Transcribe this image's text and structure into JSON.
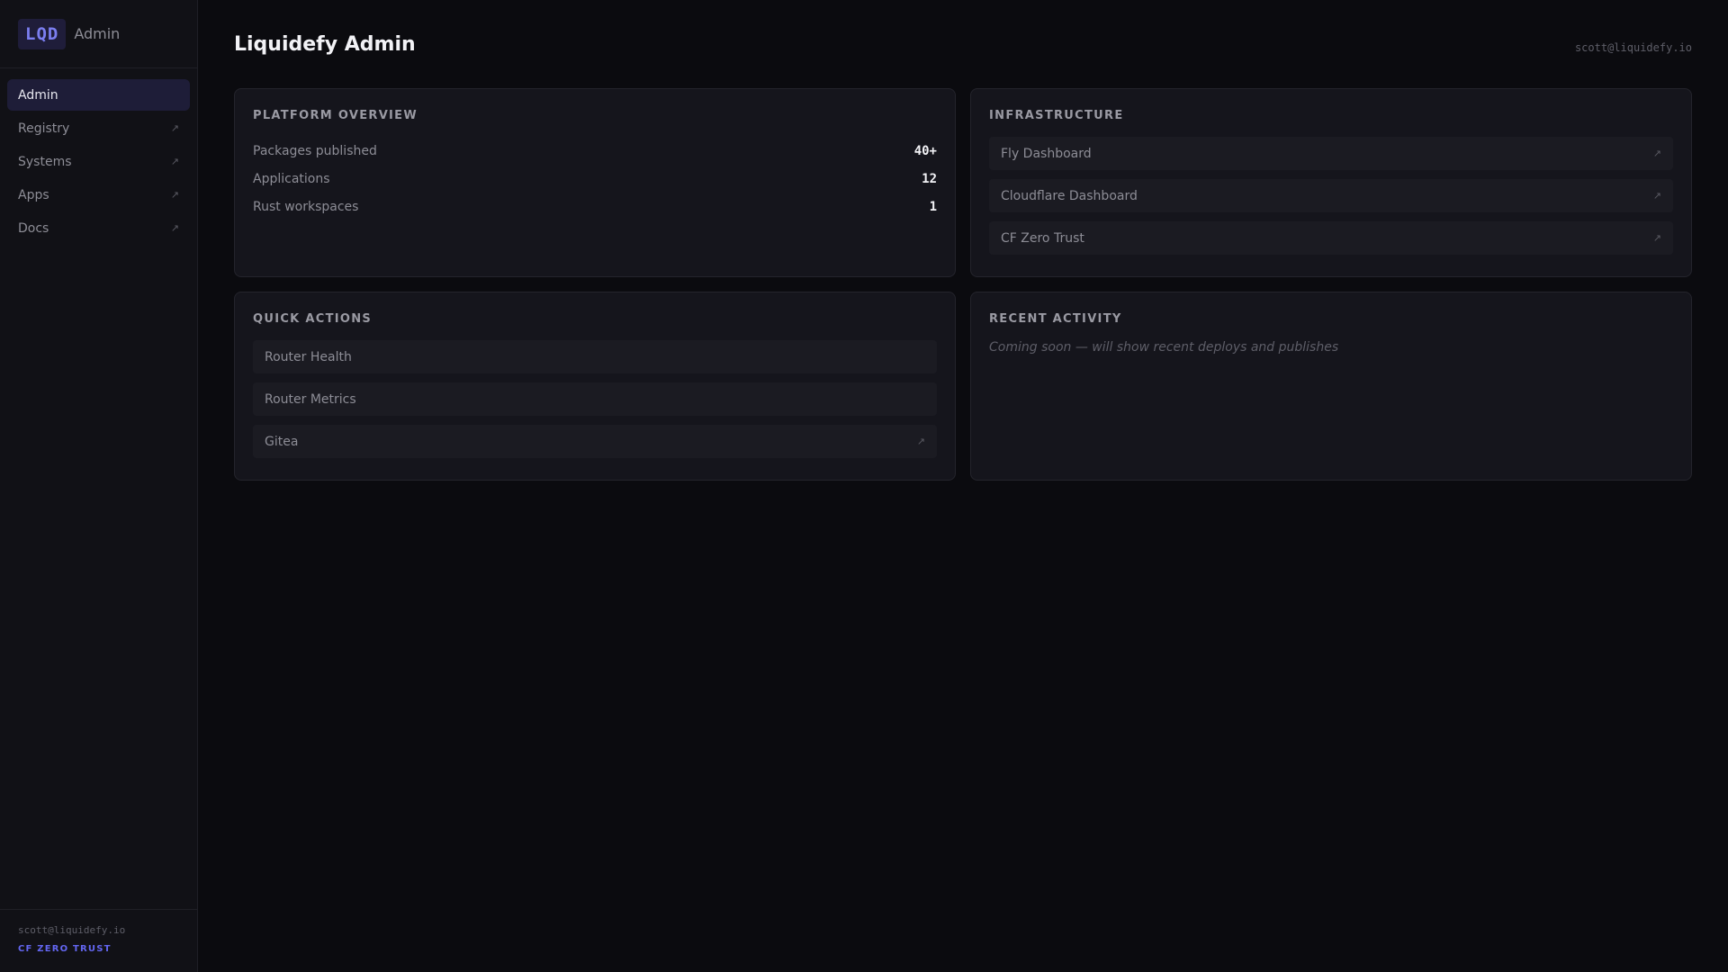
{
  "brand": {
    "logo": "LQD",
    "subtitle": "Admin"
  },
  "sidebar": {
    "items": [
      {
        "label": "Admin",
        "external": false,
        "active": true
      },
      {
        "label": "Registry",
        "external": true
      },
      {
        "label": "Systems",
        "external": true
      },
      {
        "label": "Apps",
        "external": true
      },
      {
        "label": "Docs",
        "external": true
      }
    ],
    "external_glyph": "↗",
    "footer": {
      "email": "scott@liquidefy.io",
      "badge": "CF ZERO TRUST"
    }
  },
  "header": {
    "title": "Liquidefy Admin",
    "user": "scott@liquidefy.io"
  },
  "overview": {
    "title": "PLATFORM OVERVIEW",
    "stats": [
      {
        "label": "Packages published",
        "value": "40+"
      },
      {
        "label": "Applications",
        "value": "12"
      },
      {
        "label": "Rust workspaces",
        "value": "1"
      }
    ]
  },
  "infrastructure": {
    "title": "INFRASTRUCTURE",
    "links": [
      {
        "label": "Fly Dashboard"
      },
      {
        "label": "Cloudflare Dashboard"
      },
      {
        "label": "CF Zero Trust"
      }
    ]
  },
  "quick_actions": {
    "title": "QUICK ACTIONS",
    "actions": [
      {
        "label": "Router Health",
        "external": false
      },
      {
        "label": "Router Metrics",
        "external": false
      },
      {
        "label": "Gitea",
        "external": true
      }
    ]
  },
  "recent_activity": {
    "title": "RECENT ACTIVITY",
    "placeholder": "Coming soon — will show recent deploys and publishes"
  },
  "colors": {
    "accent": "#6366f1",
    "background": "#0b0b0f",
    "card": "#15151c"
  }
}
